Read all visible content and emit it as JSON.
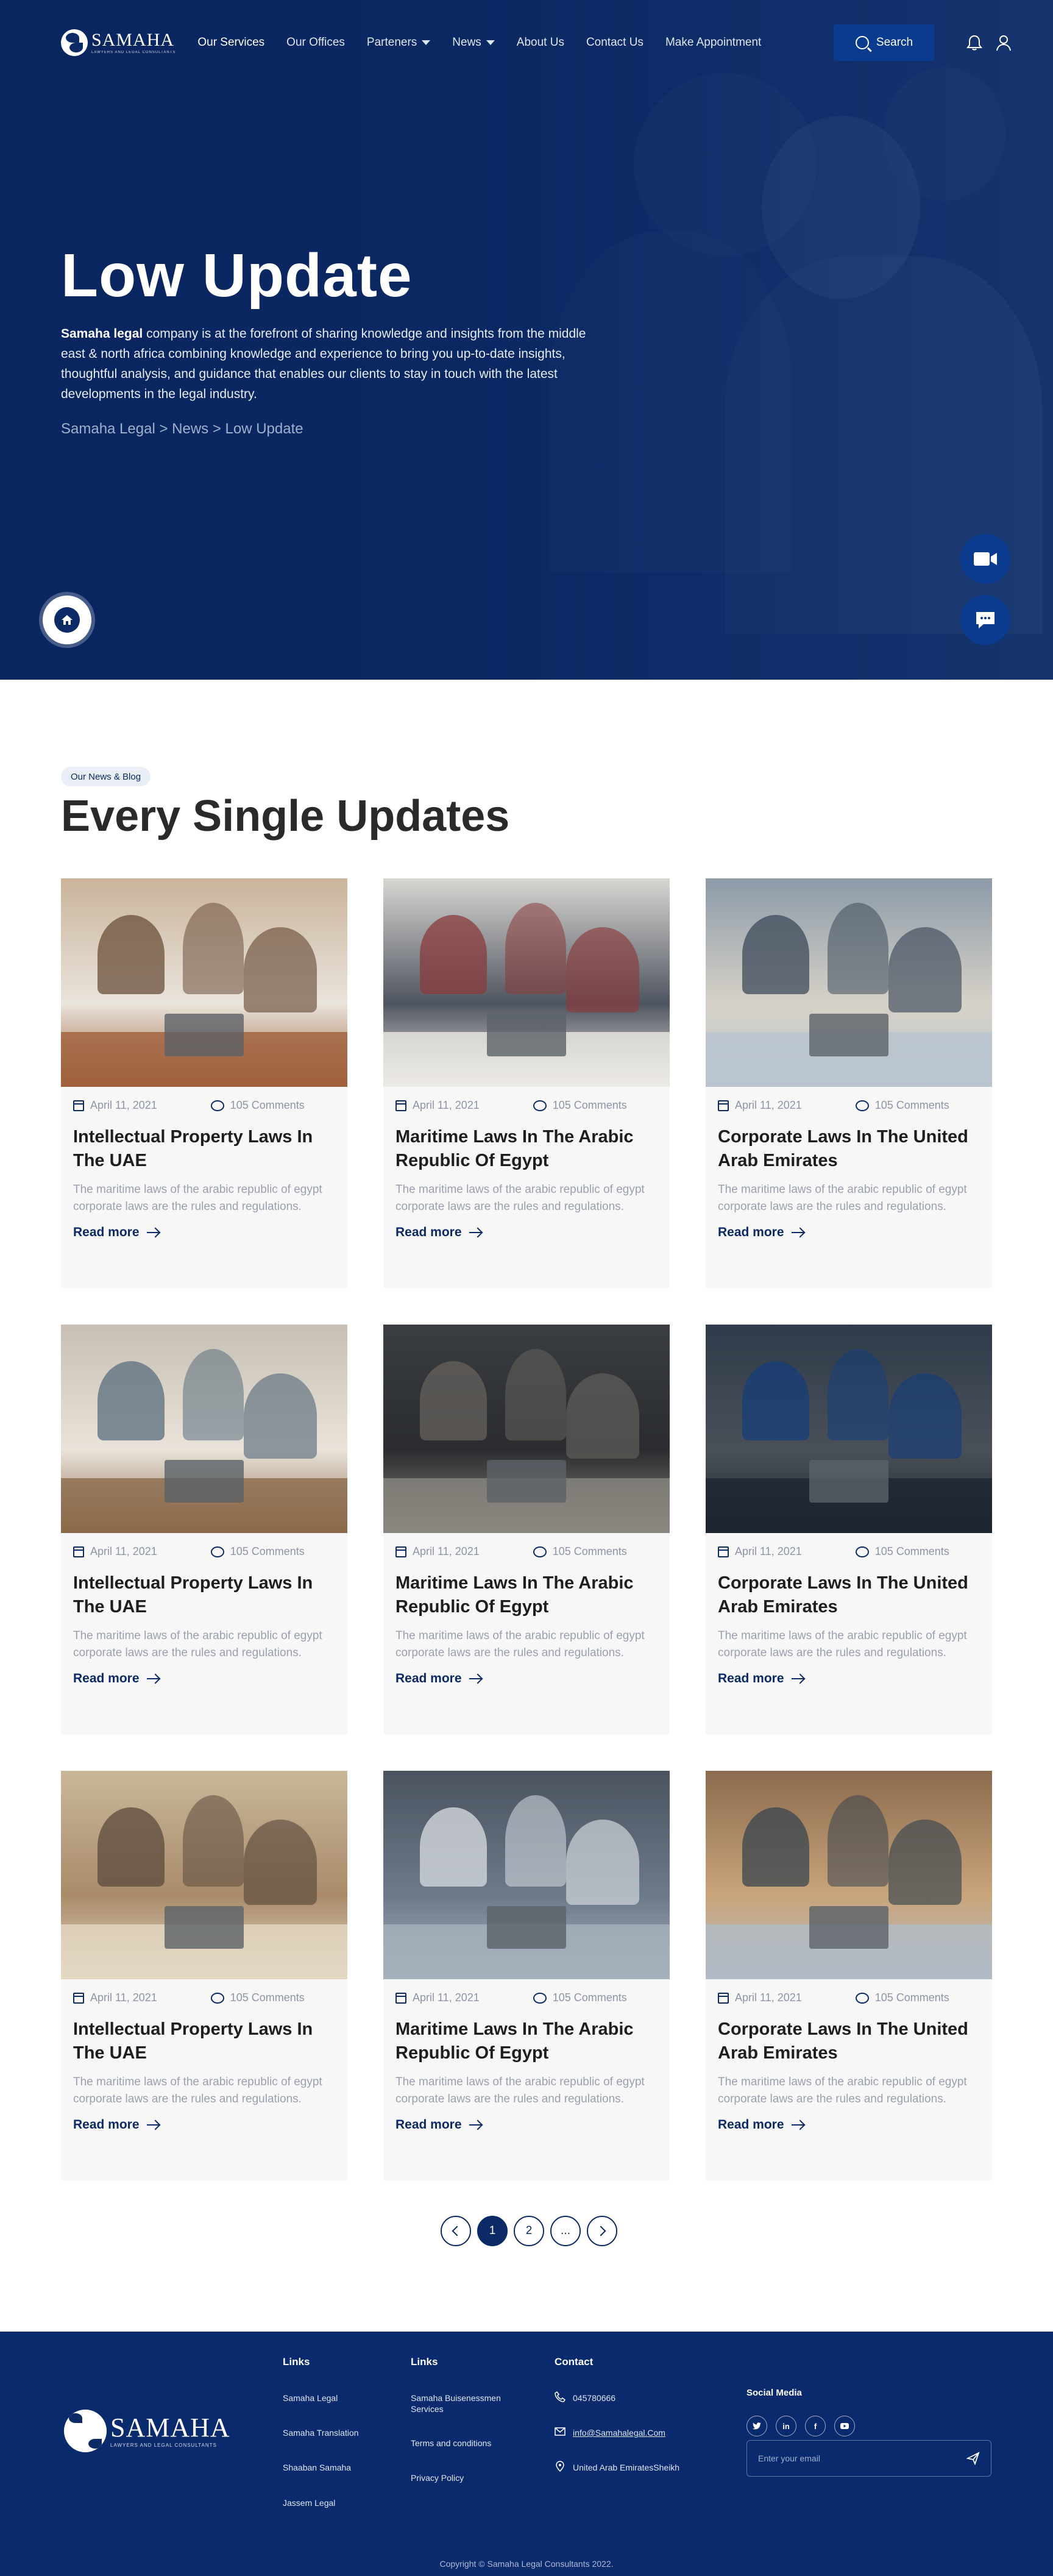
{
  "brand": {
    "name": "SAMAHA",
    "tagline": "LAWYERS AND LEGAL CONSULTANTS"
  },
  "nav": {
    "items": [
      {
        "label": "Our Services",
        "active": true
      },
      {
        "label": "Our Offices"
      },
      {
        "label": "Parteners",
        "dropdown": true
      },
      {
        "label": "News",
        "dropdown": true
      },
      {
        "label": "About Us"
      },
      {
        "label": "Contact Us"
      },
      {
        "label": "Make Appointment"
      }
    ],
    "search_label": "Search"
  },
  "hero": {
    "title": "Low Update",
    "desc_bold": "Samaha legal",
    "desc_rest": " company is at the forefront of sharing knowledge and insights from the middle east & north africa combining knowledge and experience to bring you up-to-date insights, thoughtful analysis, and guidance that enables our clients to stay in touch with the latest developments in the legal industry.",
    "breadcrumb": "Samaha Legal > News > Low Update"
  },
  "section": {
    "badge": "Our News & Blog",
    "title": "Every Single Updates"
  },
  "cards": [
    {
      "date": "April 11, 2021",
      "comments": "105 Comments",
      "title": "Intellectual Property Laws In The UAE",
      "excerpt": "The maritime laws of the arabic republic of egypt corporate laws are the rules and regulations.",
      "more": "Read more"
    },
    {
      "date": "April 11, 2021",
      "comments": "105 Comments",
      "title": "Maritime Laws In The Arabic Republic Of Egypt",
      "excerpt": "The maritime laws of the arabic republic of egypt corporate laws are the rules and regulations.",
      "more": "Read more"
    },
    {
      "date": "April 11, 2021",
      "comments": "105 Comments",
      "title": "Corporate Laws In The United Arab Emirates",
      "excerpt": "The maritime laws of the arabic republic of egypt corporate laws are the rules and regulations.",
      "more": "Read more"
    },
    {
      "date": "April 11, 2021",
      "comments": "105 Comments",
      "title": "Intellectual Property Laws In The UAE",
      "excerpt": "The maritime laws of the arabic republic of egypt corporate laws are the rules and regulations.",
      "more": "Read more"
    },
    {
      "date": "April 11, 2021",
      "comments": "105 Comments",
      "title": "Maritime Laws In The Arabic Republic Of Egypt",
      "excerpt": "The maritime laws of the arabic republic of egypt corporate laws are the rules and regulations.",
      "more": "Read more"
    },
    {
      "date": "April 11, 2021",
      "comments": "105 Comments",
      "title": "Corporate Laws In The United Arab Emirates",
      "excerpt": "The maritime laws of the arabic republic of egypt corporate laws are the rules and regulations.",
      "more": "Read more"
    },
    {
      "date": "April 11, 2021",
      "comments": "105 Comments",
      "title": "Intellectual Property Laws In The UAE",
      "excerpt": "The maritime laws of the arabic republic of egypt corporate laws are the rules and regulations.",
      "more": "Read more"
    },
    {
      "date": "April 11, 2021",
      "comments": "105 Comments",
      "title": "Maritime Laws In The Arabic Republic Of Egypt",
      "excerpt": "The maritime laws of the arabic republic of egypt corporate laws are the rules and regulations.",
      "more": "Read more"
    },
    {
      "date": "April 11, 2021",
      "comments": "105 Comments",
      "title": "Corporate Laws In The United Arab Emirates",
      "excerpt": "The maritime laws of the arabic republic of egypt corporate laws are the rules and regulations.",
      "more": "Read more"
    }
  ],
  "pagination": {
    "pages": [
      "1",
      "2",
      "..."
    ],
    "current": "1"
  },
  "footer": {
    "links1": {
      "heading": "Links",
      "items": [
        "Samaha Legal",
        "Samaha Translation",
        "Shaaban Samaha",
        "Jassem Legal"
      ]
    },
    "links2": {
      "heading": "Links",
      "items": [
        "Samaha Buisenessmen Services",
        "Terms and conditions",
        "Privacy Policy"
      ]
    },
    "contact": {
      "heading": "Contact",
      "phone": "045780666",
      "email": "info@Samahalegal.Com",
      "address": "United Arab EmiratesSheikh"
    },
    "social": {
      "heading": "Social Media",
      "networks": [
        "twitter",
        "linkedin",
        "facebook",
        "youtube"
      ]
    },
    "email_placeholder": "Enter your email",
    "copyright": "Copyright © Samaha Legal Consultants 2022."
  },
  "colors": {
    "primary": "#0c2a66",
    "accent": "#0b3b8f",
    "card_bg": "#f7f7f8",
    "footer_bg": "#0a2a6e"
  },
  "icons": [
    "search-icon",
    "bell-icon",
    "user-icon",
    "home-icon",
    "video-icon",
    "chat-icon",
    "calendar-icon",
    "comment-icon",
    "arrow-right-icon",
    "chevron-left-icon",
    "chevron-right-icon",
    "phone-icon",
    "mail-icon",
    "location-icon",
    "send-icon"
  ]
}
